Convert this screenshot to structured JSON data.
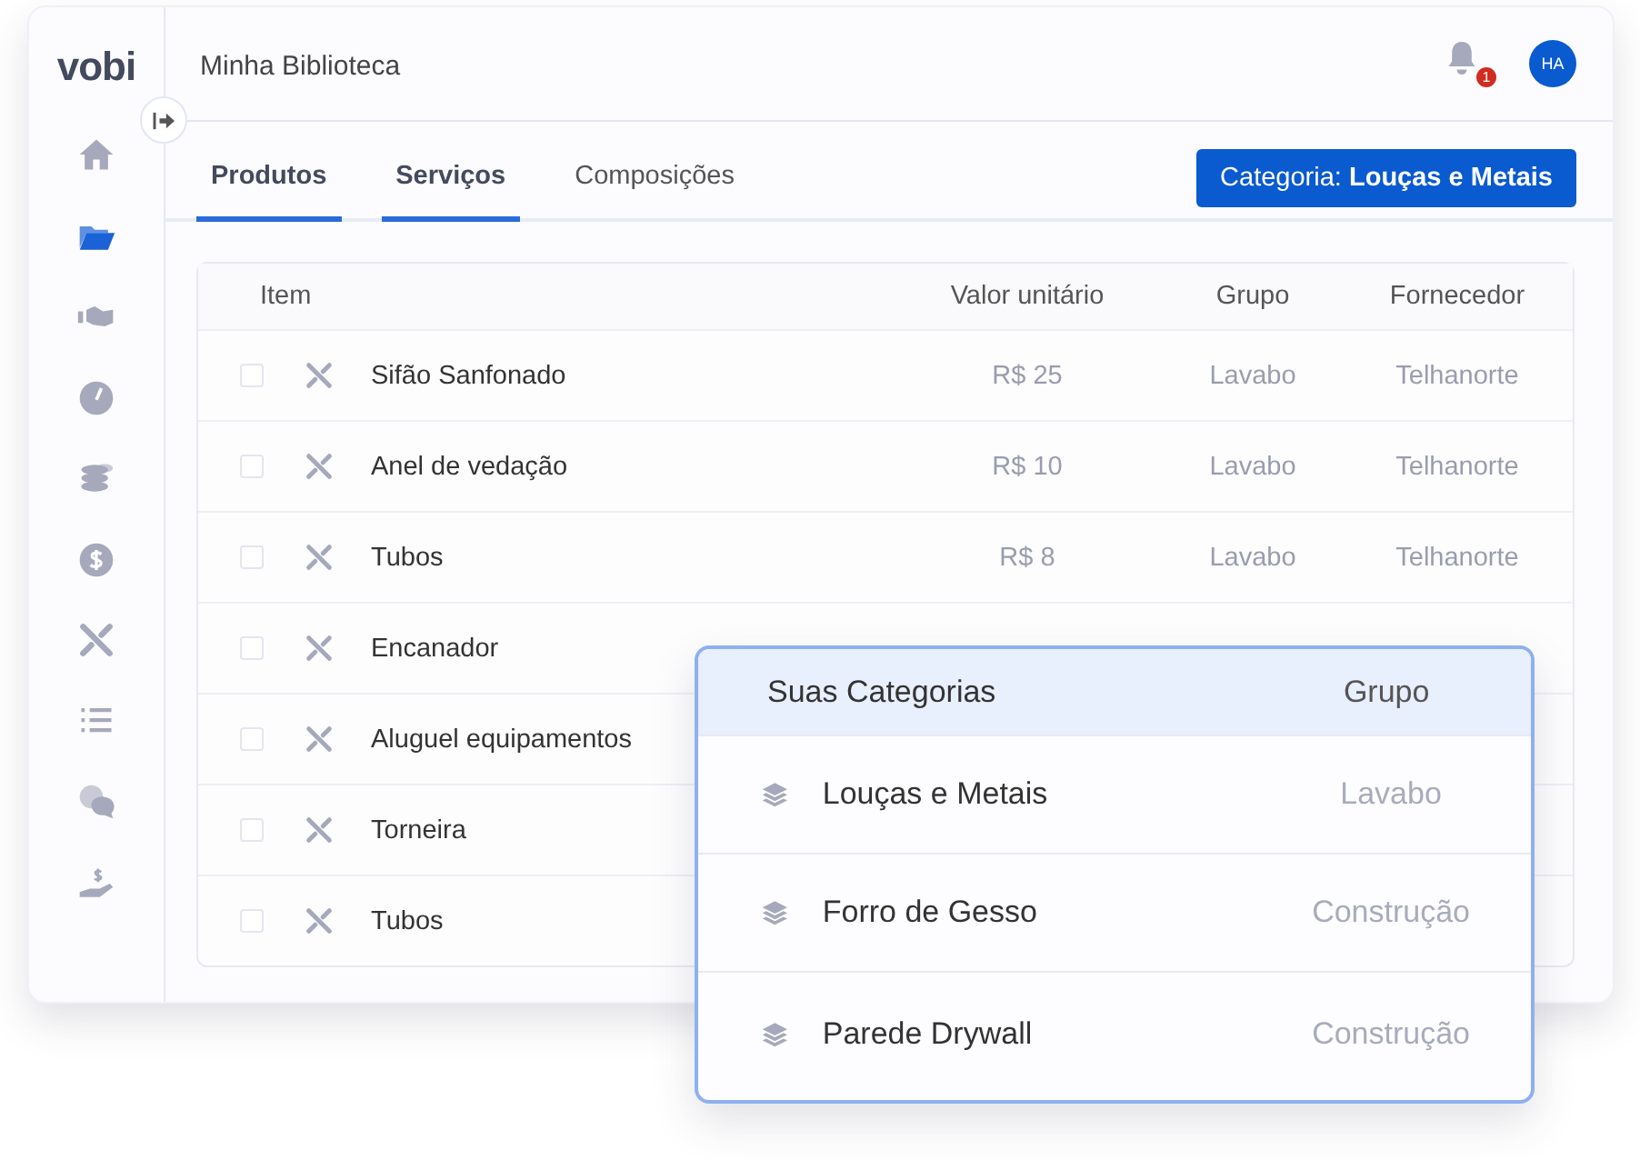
{
  "sidebar": {
    "logo": "vobi",
    "items": [
      {
        "selected": false
      },
      {
        "selected": true
      },
      {
        "selected": false
      },
      {
        "selected": false
      },
      {
        "selected": false
      },
      {
        "selected": false
      },
      {
        "selected": false
      },
      {
        "selected": false
      },
      {
        "selected": false
      },
      {
        "selected": false
      }
    ]
  },
  "header": {
    "title": "Minha Biblioteca",
    "notification_count": "1",
    "avatar": "HA"
  },
  "tabs": [
    {
      "label": "Produtos",
      "selected": true
    },
    {
      "label": "Serviços",
      "selected": true
    },
    {
      "label": "Composições",
      "selected": false
    }
  ],
  "category_button": "Categoria: **Louças e Metais**",
  "table": {
    "columns": [
      "Item",
      "Valor unitário",
      "Grupo",
      "Fornecedor"
    ],
    "rows": [
      {
        "checked": false,
        "name": "Sifão Sanfonado",
        "price": "R$ 25",
        "group": "Lavabo",
        "supplier": "Telhanorte"
      },
      {
        "checked": false,
        "name": "Anel de vedação",
        "price": "R$ 10",
        "group": "Lavabo",
        "supplier": "Telhanorte"
      },
      {
        "checked": false,
        "name": "Tubos",
        "price": "R$ 8",
        "group": "Lavabo",
        "supplier": "Telhanorte"
      },
      {
        "checked": false,
        "name": "Encanador"
      },
      {
        "checked": false,
        "name": "Aluguel equipamentos"
      },
      {
        "checked": false,
        "name": "Torneira"
      },
      {
        "checked": false,
        "name": "Tubos"
      }
    ]
  },
  "categories_popup": {
    "columns": [
      "Suas Categorias",
      "Grupo"
    ],
    "rows": [
      {
        "name": "Louças e Metais",
        "group": "Lavabo"
      },
      {
        "name": "Forro de Gesso",
        "group": "Construção"
      },
      {
        "name": "Parede Drywall",
        "group": "Construção"
      }
    ]
  }
}
